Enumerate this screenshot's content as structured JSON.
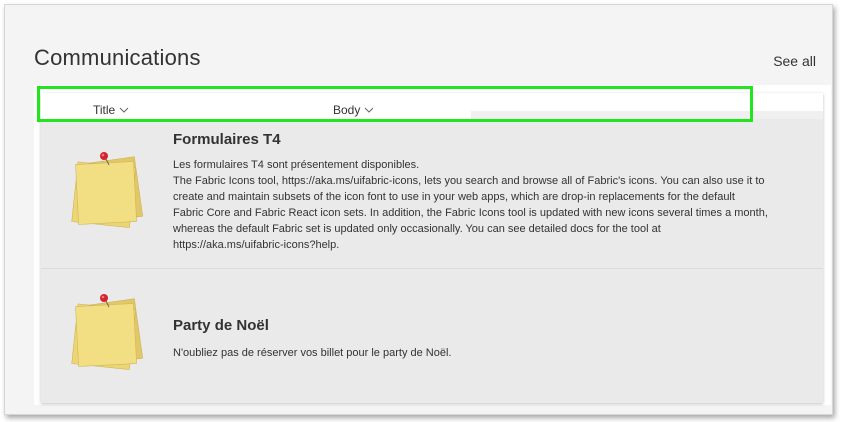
{
  "section": {
    "title": "Communications",
    "see_all_label": "See all"
  },
  "columns": {
    "title_label": "Title",
    "body_label": "Body"
  },
  "items": [
    {
      "title": "Formulaires T4",
      "body_lines": [
        "Les formulaires T4 sont présentement disponibles.",
        "The Fabric Icons tool, https://aka.ms/uifabric-icons, lets you search and browse all of Fabric's icons. You can also use it to",
        "create and maintain subsets of the icon font to use in your web apps, which are drop-in replacements for the default",
        "Fabric Core and Fabric React icon sets. In addition, the Fabric Icons tool is updated with new icons several times a month,",
        "whereas the default Fabric set is updated only occasionally. You can see detailed docs for the tool at",
        "https://aka.ms/uifabric-icons?help."
      ],
      "icon": "sticky-note-icon"
    },
    {
      "title": "Party de Noël",
      "body_lines": [
        "N'oubliez pas de réserver vos billet pour le party de Noël."
      ],
      "icon": "sticky-note-icon"
    }
  ],
  "colors": {
    "highlight": "#22e51f",
    "note_yellow": "#f3df83",
    "pin_red": "#d3232b"
  }
}
